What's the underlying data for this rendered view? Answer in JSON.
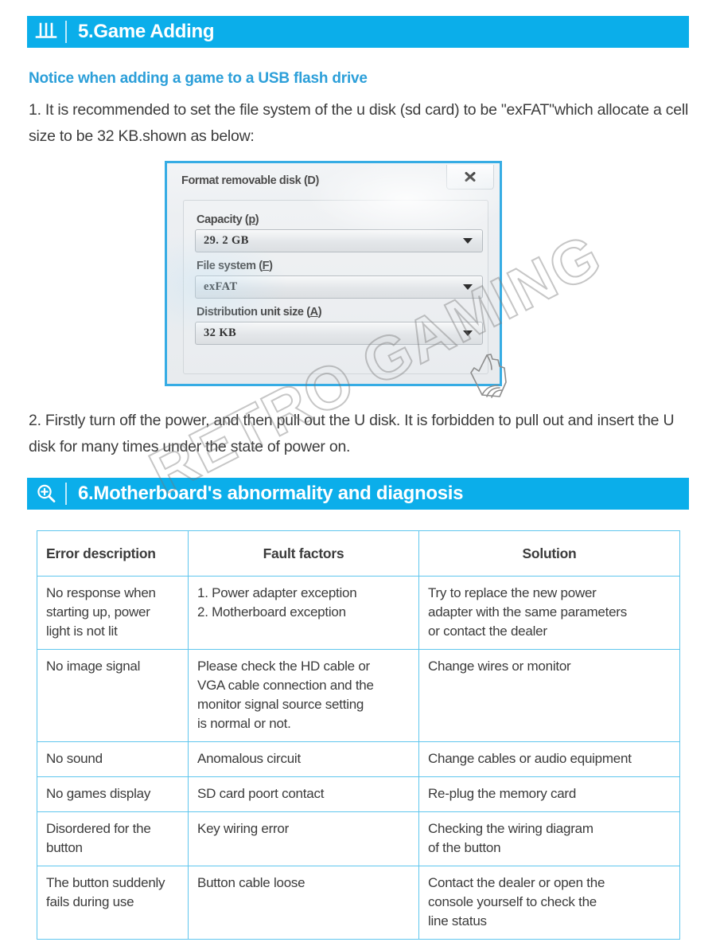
{
  "sections": {
    "game_adding": {
      "icon": "abacus-icon",
      "title": "5.Game Adding"
    },
    "diagnosis": {
      "icon": "magnifier-plus-icon",
      "title": "6.Motherboard's abnormality and diagnosis"
    }
  },
  "notice": {
    "heading": "Notice when adding a game to a USB flash drive",
    "para1": "1. It is recommended to set the file system of the u disk (sd card) to be \"exFAT\"which allocate a cell size to be 32 KB.shown as below:",
    "para2": "2. Firstly turn off the power, and then pull out the U disk. It is forbidden to pull out and insert the U disk for many times under the state of power on."
  },
  "format_dialog": {
    "title": "Format removable disk (D)",
    "close_icon": "close-x-icon",
    "fields": [
      {
        "label_text": "Capacity (",
        "mnemonic": "p",
        "label_tail": ")",
        "value": "29. 2  GB"
      },
      {
        "label_text": "File system (",
        "mnemonic": "F",
        "label_tail": ")",
        "value": "exFAT"
      },
      {
        "label_text": "Distribution unit size (",
        "mnemonic": "A",
        "label_tail": ")",
        "value": "32  KB"
      }
    ],
    "cursor_icon": "pointing-hand-cursor-icon"
  },
  "diagnosis_table": {
    "headers": [
      "Error description",
      "Fault factors",
      "Solution"
    ],
    "rows": [
      {
        "error": [
          "No response when",
          "starting up, power",
          "light is not lit"
        ],
        "factors": [
          "1. Power adapter exception",
          "2.  Motherboard exception"
        ],
        "solution": [
          "Try to replace the new power",
          "adapter with the same parameters",
          "or contact the dealer"
        ]
      },
      {
        "error": [
          "No image signal"
        ],
        "factors": [
          "Please check the HD cable or",
          "VGA cable connection and the",
          "monitor signal source setting",
          "is normal or not."
        ],
        "solution": [
          "Change wires or monitor"
        ]
      },
      {
        "error": [
          "No sound"
        ],
        "factors": [
          "Anomalous circuit"
        ],
        "solution": [
          "Change cables or audio equipment"
        ]
      },
      {
        "error": [
          "No games display"
        ],
        "factors": [
          "SD card poort contact"
        ],
        "solution": [
          "Re-plug the memory card"
        ]
      },
      {
        "error": [
          "Disordered for the",
          "button"
        ],
        "factors": [
          "Key wiring error"
        ],
        "solution": [
          "Checking the wiring diagram",
          "of the button"
        ]
      },
      {
        "error": [
          "The button suddenly",
          "fails during use"
        ],
        "factors": [
          "Button cable loose"
        ],
        "solution": [
          "Contact the dealer or open the",
          "console yourself to check the",
          "line status"
        ]
      }
    ]
  },
  "watermark": {
    "text": "RETRO  GAMING"
  },
  "colors": {
    "accent_blue": "#0BAEEA",
    "heading_blue": "#2C9FD9",
    "table_border": "#5FC6EE",
    "body_text": "#3b3b3b"
  }
}
